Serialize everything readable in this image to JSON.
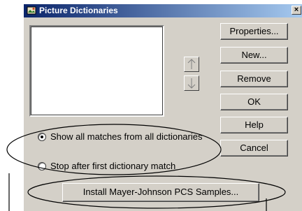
{
  "window": {
    "title": "Picture Dictionaries",
    "close_label": "×"
  },
  "icons": {
    "app": "picture-dictionaries-icon",
    "move_up": "arrow-up-icon",
    "move_down": "arrow-down-icon",
    "close": "close-icon"
  },
  "buttons": {
    "properties": "Properties...",
    "new": "New...",
    "remove": "Remove",
    "ok": "OK",
    "help": "Help",
    "cancel": "Cancel"
  },
  "options": {
    "show_all": {
      "label": "Show all matches from all dictionaries",
      "checked": true
    },
    "stop_first": {
      "label": "Stop after first dictionary match",
      "checked": false
    }
  },
  "install": {
    "label": "Install Mayer-Johnson PCS Samples..."
  },
  "dictionaries": [],
  "colors": {
    "dialog_bg": "#d4d0c8",
    "titlebar_start": "#0a246a",
    "titlebar_end": "#a6caf0"
  }
}
